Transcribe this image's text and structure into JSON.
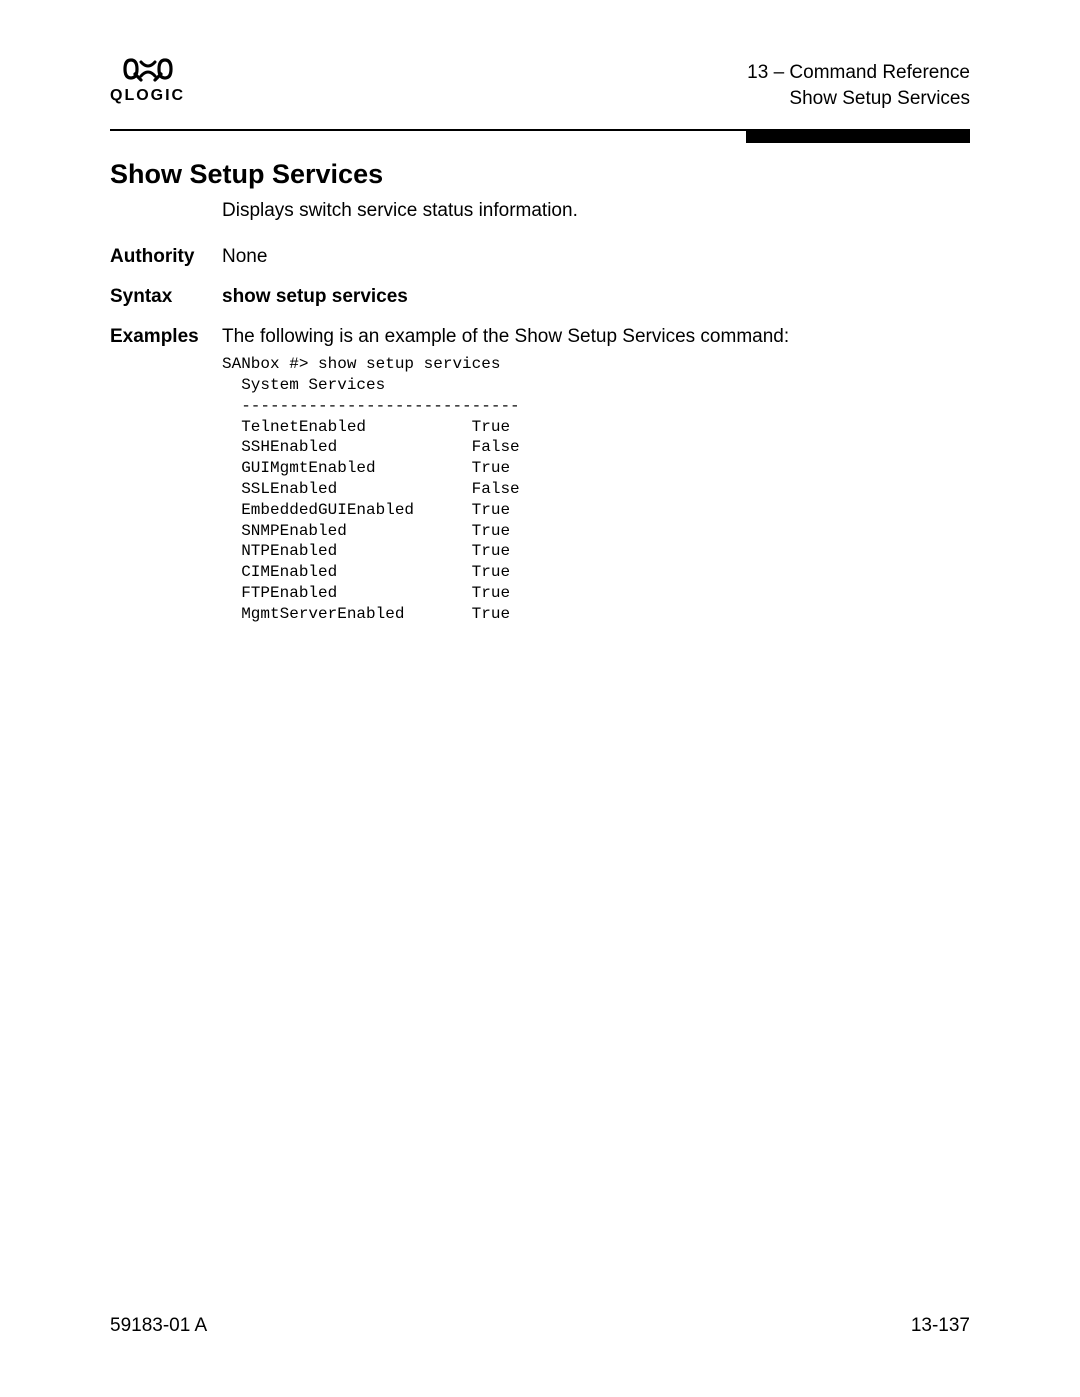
{
  "header": {
    "logo_text": "QLOGIC",
    "chapter": "13 – Command Reference",
    "section": "Show Setup Services"
  },
  "title": "Show Setup Services",
  "description": "Displays switch service status information.",
  "rows": {
    "authority": {
      "label": "Authority",
      "value": "None"
    },
    "syntax": {
      "label": "Syntax",
      "value": "show setup services"
    },
    "examples": {
      "label": "Examples",
      "value": "The following is an example of the Show Setup Services command:"
    }
  },
  "code": "SANbox #> show setup services\n  System Services\n  -----------------------------\n  TelnetEnabled           True\n  SSHEnabled              False\n  GUIMgmtEnabled          True\n  SSLEnabled              False\n  EmbeddedGUIEnabled      True\n  SNMPEnabled             True\n  NTPEnabled              True\n  CIMEnabled              True\n  FTPEnabled              True\n  MgmtServerEnabled       True",
  "footer": {
    "doc_id": "59183-01 A",
    "page": "13-137"
  }
}
